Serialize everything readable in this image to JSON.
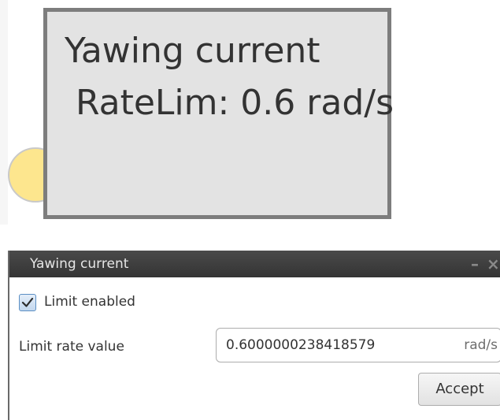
{
  "canvas": {
    "node": {
      "title": "Yawing current",
      "subtitle": "RateLim: 0.6 rad/s"
    }
  },
  "dialog": {
    "title": "Yawing current",
    "controls": {
      "minimize_glyph": "–",
      "close_glyph": "×"
    },
    "limit_enabled": {
      "label": "Limit enabled",
      "checked": true
    },
    "limit_rate": {
      "label": "Limit rate value",
      "value": "0.6000000238418579",
      "unit": "rad/s"
    },
    "accept_label": "Accept"
  },
  "colors": {
    "node_fill": "#e3e3e3",
    "node_border": "#7d7d7d",
    "port_fill": "#fde68e",
    "titlebar": "#3d3d3d",
    "checkbox_accent": "#5b8fc4"
  },
  "icons": {
    "checkbox": "checkmark-icon",
    "minimize": "minimize-icon",
    "close": "close-icon"
  }
}
